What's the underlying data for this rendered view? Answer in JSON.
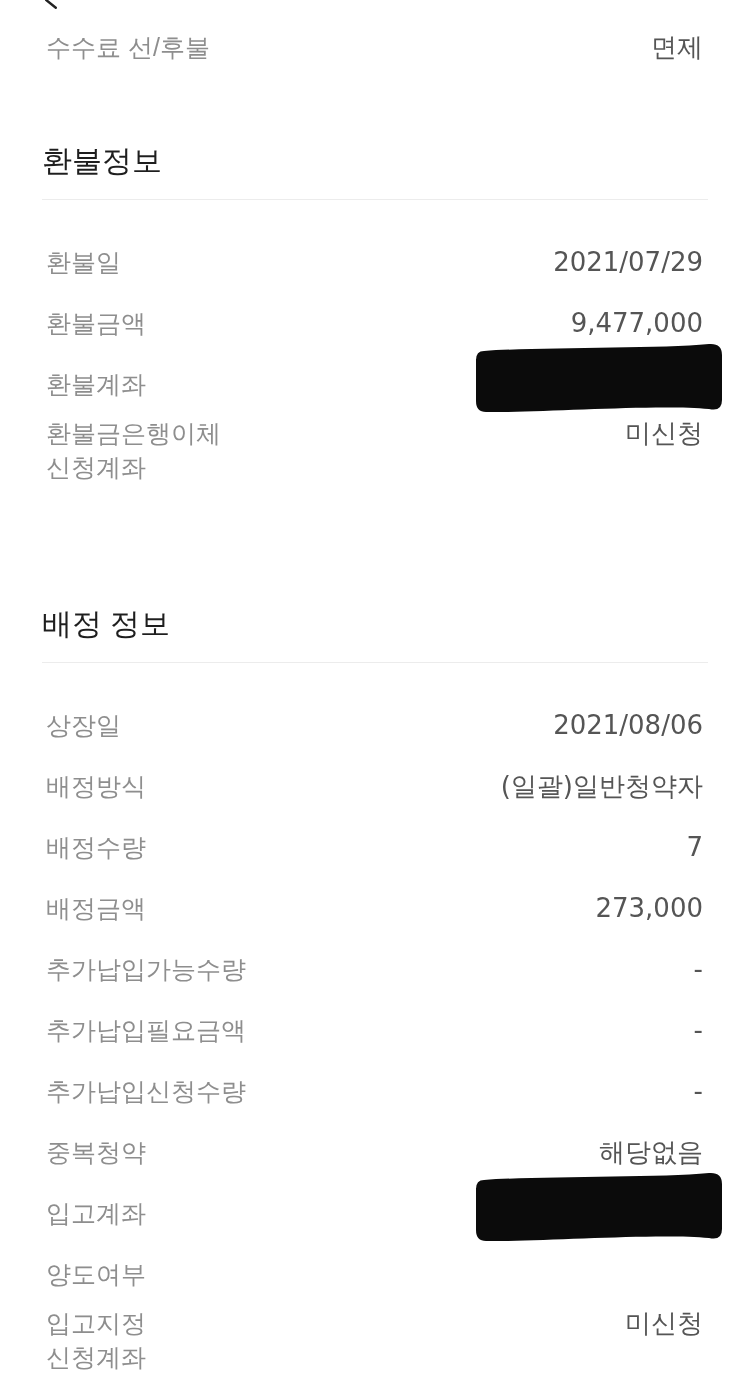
{
  "sections": [
    {
      "rows": [
        {
          "label": "수수료 선/후불",
          "value": "면제",
          "redacted": false
        }
      ]
    },
    {
      "title": "환불정보",
      "rows": [
        {
          "label": "환불일",
          "value": "2021/07/29",
          "redacted": false
        },
        {
          "label": "환불금액",
          "value": "9,477,000",
          "redacted": false
        },
        {
          "label": "환불계좌",
          "redacted": true
        },
        {
          "label": "환불금은행이체\n신청계좌",
          "value": "미신청",
          "redacted": false
        }
      ]
    },
    {
      "title": "배정 정보",
      "rows": [
        {
          "label": "상장일",
          "value": "2021/08/06",
          "redacted": false
        },
        {
          "label": "배정방식",
          "value": "(일괄)일반청약자",
          "redacted": false
        },
        {
          "label": "배정수량",
          "value": "7",
          "redacted": false
        },
        {
          "label": "배정금액",
          "value": "273,000",
          "redacted": false
        },
        {
          "label": "추가납입가능수량",
          "value": "-",
          "redacted": false
        },
        {
          "label": "추가납입필요금액",
          "value": "-",
          "redacted": false
        },
        {
          "label": "추가납입신청수량",
          "value": "-",
          "redacted": false
        },
        {
          "label": "중복청약",
          "value": "해당없음",
          "redacted": false
        },
        {
          "label": "입고계좌",
          "redacted": true
        },
        {
          "label": "양도여부",
          "redacted": false
        },
        {
          "label": "입고지정\n신청계좌",
          "value": "미신청",
          "redacted": false
        }
      ]
    }
  ]
}
